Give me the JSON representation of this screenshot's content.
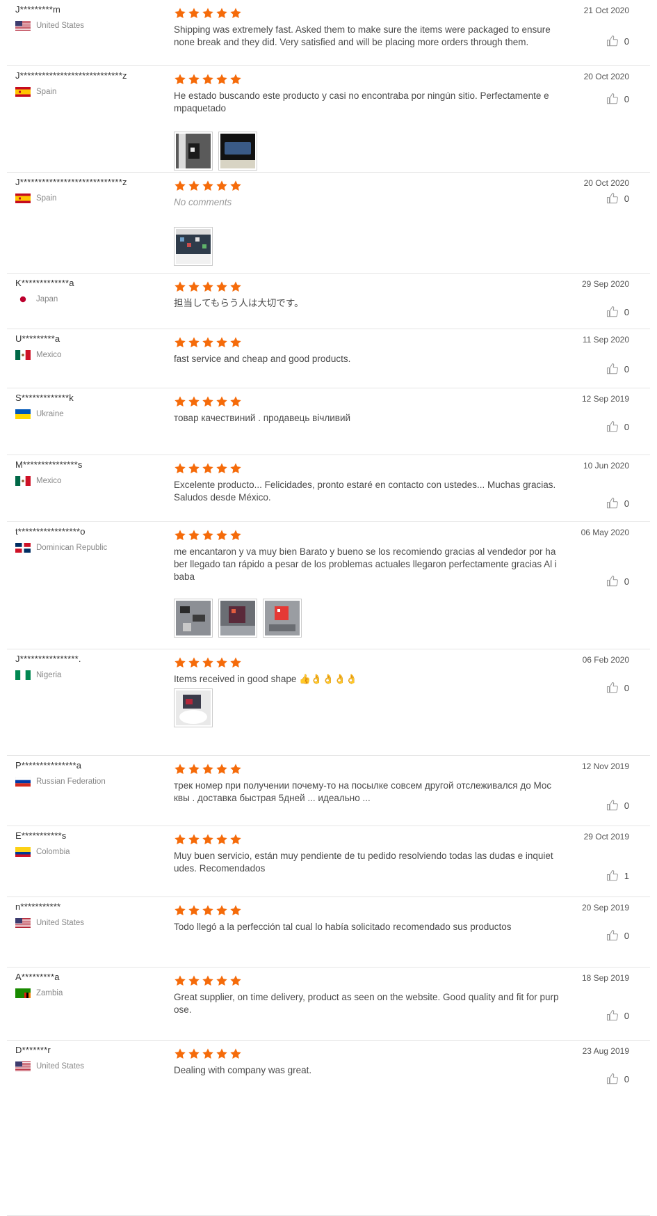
{
  "colors": {
    "star": "#f56b0a",
    "divider": "#e5e5e5",
    "thumb": "#999999"
  },
  "reviews": [
    {
      "user": "J*********m",
      "country": "United States",
      "flag": "us",
      "date": "21 Oct 2020",
      "text": "Shipping was extremely fast. Asked them to make sure the items were packaged to ensure none break and they did. Very satisfied and will be placing more orders through them.",
      "helpful": "0",
      "photos": []
    },
    {
      "user": "J****************************z",
      "country": "Spain",
      "flag": "es",
      "date": "20 Oct 2020",
      "text": "He estado buscando este producto y casi no encontraba por ningún sitio. Perfectamente e mpaquetado",
      "helpful": "0",
      "photos": [
        "photo-dark-package",
        "photo-dark-device"
      ]
    },
    {
      "user": "J****************************z",
      "country": "Spain",
      "flag": "es",
      "date": "20 Oct 2020",
      "text": "No comments",
      "empty": true,
      "helpful": "0",
      "photos": [
        "photo-components"
      ]
    },
    {
      "user": "K*************a",
      "country": "Japan",
      "flag": "jp",
      "date": "29 Sep 2020",
      "text": "担当してもらう人は大切です。",
      "helpful": "0",
      "photos": []
    },
    {
      "user": "U*********a",
      "country": "Mexico",
      "flag": "mx",
      "date": "11 Sep 2020",
      "text": "fast service and cheap and good products.",
      "helpful": "0",
      "photos": []
    },
    {
      "user": "S*************k",
      "country": "Ukraine",
      "flag": "ua",
      "date": "12 Sep 2019",
      "text": "товар качествиний . продавець вічливий",
      "helpful": "0",
      "photos": []
    },
    {
      "user": "M***************s",
      "country": "Mexico",
      "flag": "mx",
      "date": "10 Jun 2020",
      "text": "Excelente producto... Felicidades, pronto estaré en contacto con ustedes... Muchas gracias. Saludos desde México.",
      "helpful": "0",
      "photos": []
    },
    {
      "user": "t*****************o",
      "country": "Dominican Republic",
      "flag": "do",
      "date": "06 May 2020",
      "text": "me encantaron y va muy bien Barato y bueno se los recomiendo gracias al vendedor por ha ber llegado tan rápido a pesar de los problemas actuales  llegaron perfectamente gracias Al i baba",
      "helpful": "0",
      "photos": [
        "photo-parts-1",
        "photo-parts-2",
        "photo-red-chip"
      ]
    },
    {
      "user": "J****************.",
      "country": "Nigeria",
      "flag": "ng",
      "date": "06 Feb 2020",
      "text": "Items received in good shape 👍👌👌👌👌",
      "helpful": "0",
      "photos": [
        "photo-box"
      ]
    },
    {
      "user": "P***************a",
      "country": "Russian Federation",
      "flag": "ru",
      "date": "12 Nov 2019",
      "text": "трек номер при получении почему-то на посылке совсем другой отслеживался до Мос квы . доставка быстрая 5дней ... идеально ...",
      "helpful": "0",
      "photos": []
    },
    {
      "user": "E***********s",
      "country": "Colombia",
      "flag": "co",
      "date": "29 Oct 2019",
      "text": "Muy buen servicio, están muy pendiente de tu pedido resolviendo todas las dudas e inquiet udes. Recomendados",
      "helpful": "1",
      "photos": []
    },
    {
      "user": "n***********",
      "country": "United States",
      "flag": "us",
      "date": "20 Sep 2019",
      "text": "Todo llegó a la perfección tal cual lo había solicitado recomendado sus productos",
      "helpful": "0",
      "photos": []
    },
    {
      "user": "A*********a",
      "country": "Zambia",
      "flag": "zm",
      "date": "18 Sep 2019",
      "text": "Great supplier, on time delivery, product as seen on the website. Good quality and fit for purp ose.",
      "helpful": "0",
      "photos": []
    },
    {
      "user": "D*******r",
      "country": "United States",
      "flag": "us",
      "date": "23 Aug 2019",
      "text": "Dealing with company was great.",
      "helpful": "0",
      "photos": []
    }
  ]
}
